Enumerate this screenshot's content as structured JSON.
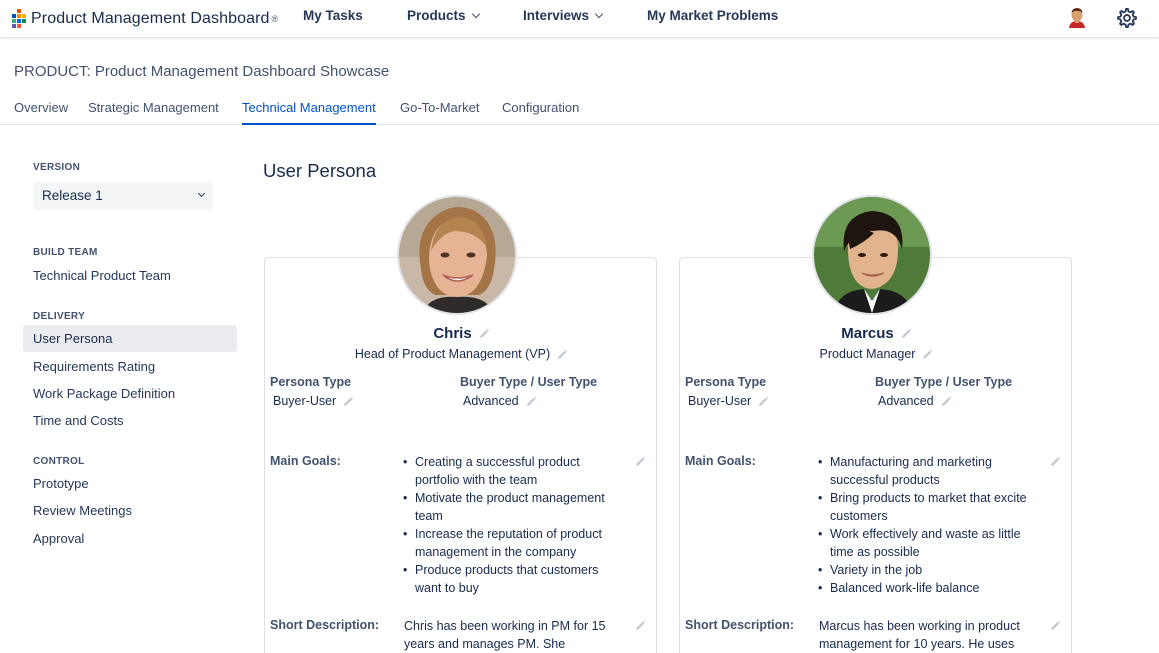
{
  "topnav": {
    "app_title": "Product Management Dashboard",
    "registered": "®",
    "items": [
      {
        "label": "My Tasks"
      },
      {
        "label": "Products"
      },
      {
        "label": "Interviews"
      },
      {
        "label": "My Market Problems"
      }
    ]
  },
  "product": {
    "title": "PRODUCT: Product Management Dashboard Showcase"
  },
  "tabs": [
    {
      "label": "Overview"
    },
    {
      "label": "Strategic Management"
    },
    {
      "label": "Technical Management"
    },
    {
      "label": "Go-To-Market"
    },
    {
      "label": "Configuration"
    }
  ],
  "sidebar": {
    "version_heading": "VERSION",
    "version_value": "Release 1",
    "build_team_heading": "BUILD TEAM",
    "build_team_items": [
      {
        "label": "Technical Product Team"
      }
    ],
    "delivery_heading": "DELIVERY",
    "delivery_items": [
      {
        "label": "User Persona"
      },
      {
        "label": "Requirements Rating"
      },
      {
        "label": "Work Package Definition"
      },
      {
        "label": "Time and Costs"
      }
    ],
    "control_heading": "CONTROL",
    "control_items": [
      {
        "label": "Prototype"
      },
      {
        "label": "Review Meetings"
      },
      {
        "label": "Approval"
      }
    ]
  },
  "main": {
    "title": "User Persona",
    "labels": {
      "persona_type": "Persona Type",
      "buyer_type": "Buyer Type / User Type",
      "main_goals": "Main Goals:",
      "short_description": "Short Description:"
    },
    "personas": [
      {
        "name": "Chris",
        "role": "Head of Product Management (VP)",
        "persona_type": "Buyer-User",
        "buyer_type": "Advanced",
        "goals": [
          {
            "l1": "Creating a successful product",
            "l2": "portfolio with the team"
          },
          {
            "l1": "Motivate the product management",
            "l2": "team"
          },
          {
            "l1": "Increase the reputation of product",
            "l2": "management in the company"
          },
          {
            "l1": "Produce products that customers",
            "l2": "want to buy"
          }
        ],
        "description_l1": "Chris has been working in PM for 15",
        "description_l2": "years and manages PM. She"
      },
      {
        "name": "Marcus",
        "role": "Product Manager",
        "persona_type": "Buyer-User",
        "buyer_type": "Advanced",
        "goals": [
          {
            "l1": "Manufacturing and marketing",
            "l2": "successful products"
          },
          {
            "l1": "Bring products to market that excite",
            "l2": "customers"
          },
          {
            "l1": "Work effectively and waste as little",
            "l2": "time as possible"
          },
          {
            "l1": "Variety in the job",
            "l2": ""
          },
          {
            "l1": "Balanced work-life balance",
            "l2": ""
          }
        ],
        "description_l1": "Marcus has been working in product",
        "description_l2": "management for 10 years. He uses"
      }
    ]
  },
  "colors": {
    "accent": "#0052cc",
    "text": "#172b4d",
    "muted": "#42526e",
    "border": "#dfe1e6"
  },
  "icons": [
    "logo-icon",
    "chevron-down-icon",
    "user-avatar-icon",
    "gear-icon",
    "pencil-icon"
  ]
}
